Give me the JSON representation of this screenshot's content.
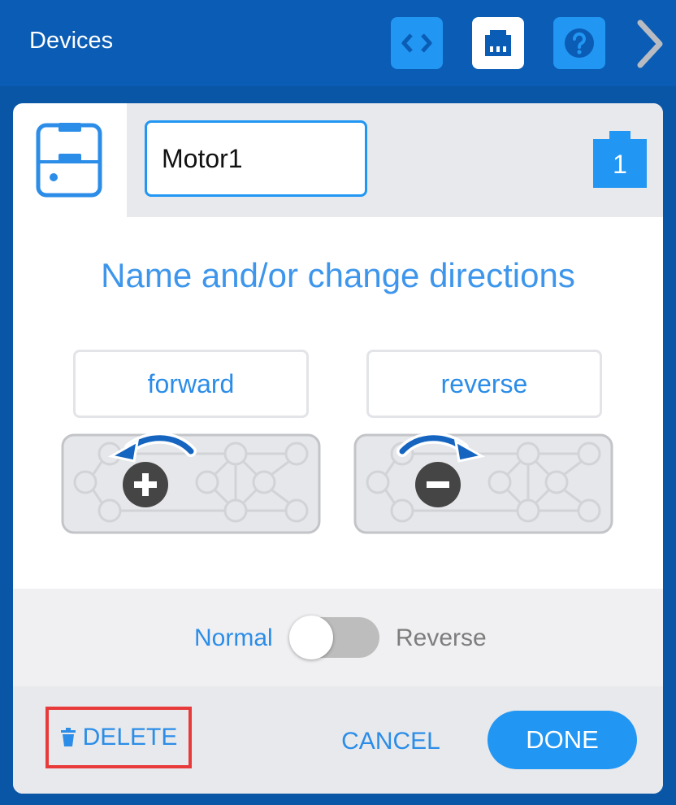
{
  "topbar": {
    "title": "Devices",
    "buttons": [
      {
        "icon": "code-brackets-icon",
        "active": false
      },
      {
        "icon": "brain-port-icon",
        "active": true
      },
      {
        "icon": "help-icon",
        "active": false
      }
    ],
    "next_icon": "chevron-right-icon"
  },
  "device": {
    "icon": "motor-device-icon",
    "name_value": "Motor1",
    "port_number": "1"
  },
  "dialog": {
    "heading": "Name and/or change directions",
    "forward_label": "forward",
    "reverse_label": "reverse",
    "toggle": {
      "left_label": "Normal",
      "right_label": "Reverse",
      "selected": "Normal"
    }
  },
  "footer": {
    "delete_label": "DELETE",
    "delete_icon": "trash-icon",
    "cancel_label": "CANCEL",
    "done_label": "DONE"
  },
  "colors": {
    "topbar": "#0a5cb4",
    "accent": "#2196f3",
    "text_accent": "#2b8de8",
    "highlight_border": "#e83a3a"
  }
}
